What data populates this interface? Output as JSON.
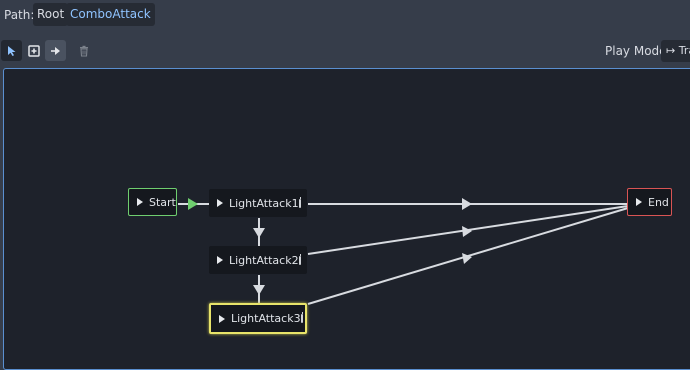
{
  "path_bar": {
    "label": "Path:",
    "crumbs": [
      "Root",
      "ComboAttack"
    ]
  },
  "toolbar": {
    "tools": [
      {
        "icon": "select-arrow-icon",
        "active": true
      },
      {
        "icon": "add-node-icon",
        "active": false
      },
      {
        "icon": "connect-transition-icon",
        "active": false
      },
      {
        "icon": "trash-icon",
        "active": false
      }
    ],
    "play_mode_label": "Play Mode:",
    "play_mode_value": "Tra"
  },
  "graph": {
    "nodes": {
      "start": "Start",
      "end": "End",
      "la1": "LightAttack1",
      "la2": "LightAttack2",
      "la3": "LightAttack3"
    },
    "selected_node": "LightAttack3"
  },
  "colors": {
    "accent": "#8fc3ff",
    "start_border": "#6fce6f",
    "end_border": "#d95454",
    "selected_border": "#e8e46a",
    "transition_line": "#d8dbe0",
    "auto_transition": "#6fce6f"
  }
}
